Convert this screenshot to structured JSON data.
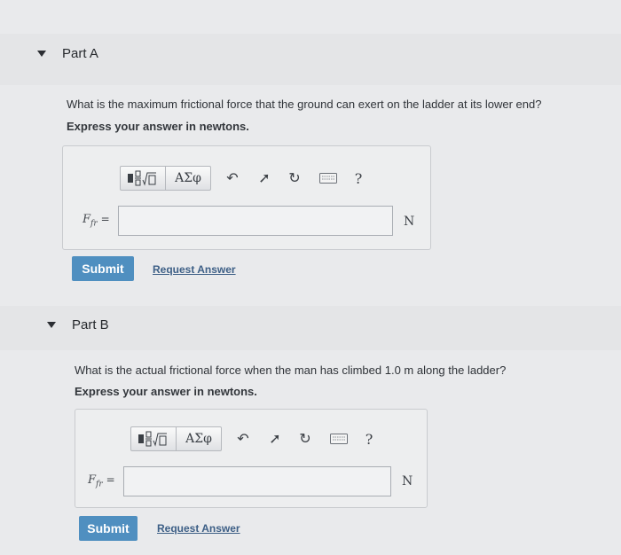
{
  "part_a": {
    "header": "Part A",
    "question": "What is the maximum frictional force that the ground can exert on the ladder at its lower end?",
    "instruction": "Express your answer in newtons.",
    "toolbar": {
      "templates_icon": "fraction-sqrt-template-icon",
      "symbols_label": "ΑΣφ",
      "undo_icon": "undo-icon",
      "redo_icon": "redo-icon",
      "reset_icon": "reset-icon",
      "keyboard_icon": "keyboard-icon",
      "help_label": "?"
    },
    "var_main": "F",
    "var_sub": "fr",
    "equals": "=",
    "input_value": "",
    "unit": "N",
    "submit_label": "Submit",
    "request_label": "Request Answer"
  },
  "part_b": {
    "header": "Part B",
    "question": "What is the actual frictional force when the man has climbed 1.0 m along the ladder?",
    "instruction": "Express your answer in newtons.",
    "toolbar": {
      "templates_icon": "fraction-sqrt-template-icon",
      "symbols_label": "ΑΣφ",
      "undo_icon": "undo-icon",
      "redo_icon": "redo-icon",
      "reset_icon": "reset-icon",
      "keyboard_icon": "keyboard-icon",
      "help_label": "?"
    },
    "var_main": "F",
    "var_sub": "fr",
    "equals": "=",
    "input_value": "",
    "unit": "N",
    "submit_label": "Submit",
    "request_label": "Request Answer"
  },
  "colors": {
    "submit_bg": "#4f8fc0",
    "link": "#3d5f86",
    "page_bg": "#e9eaec"
  }
}
